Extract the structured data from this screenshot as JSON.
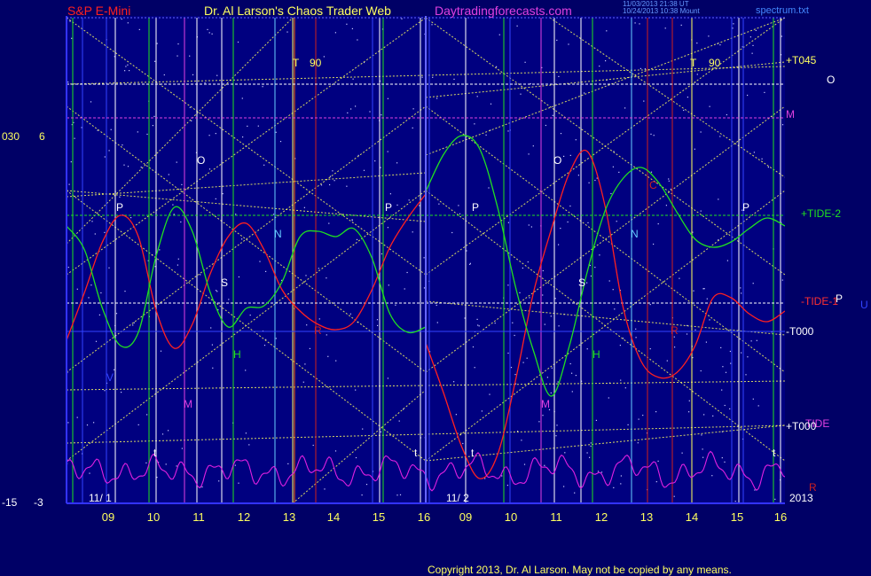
{
  "header": {
    "instrument": "S&P E-Mini",
    "title": "Dr. Al Larson's Chaos Trader Web",
    "site": "Daytradingforecasts.com",
    "timestamp_1": "11/03/2013 21:38 UT",
    "timestamp_2": "10/24/2013 10:38 Mount",
    "file": "spectrum.txt"
  },
  "left_axis": {
    "top_a": "030",
    "top_b": "6",
    "bottom_a": "-15",
    "bottom_b": "-3"
  },
  "right_labels": {
    "t045": "+T045",
    "o": "O",
    "m": "M",
    "tide2": "+TIDE-2",
    "tide1": "-TIDE-1",
    "p": "P",
    "u": "U",
    "t000_top": "-T000",
    "tide": "TIDE",
    "t000_bottom": "+T000",
    "r": "R",
    "year": "2013"
  },
  "footer": {
    "copyright": "Copyright 2013, Dr. Al Larson. May not be copied by any means."
  },
  "colors": {
    "background": "#000066",
    "price": "#ff2020",
    "flux": "#20e020",
    "spectrum": "#e020e0",
    "grid": "#ffff60",
    "white_line": "#ffffff",
    "frame": "#3333ff"
  },
  "chart_data": {
    "type": "line",
    "panels": [
      {
        "date_label": "11/ 1",
        "hour_ticks": [
          "09",
          "10",
          "11",
          "12",
          "13",
          "14",
          "15",
          "16"
        ],
        "markers": [
          {
            "text": "T",
            "kind": "yellow"
          },
          {
            "text": "90",
            "kind": "yellow"
          },
          {
            "text": "O",
            "kind": "white"
          },
          {
            "text": "P",
            "kind": "white"
          },
          {
            "text": "P",
            "kind": "white"
          },
          {
            "text": "N",
            "kind": "cyan"
          },
          {
            "text": "S",
            "kind": "white"
          },
          {
            "text": "H",
            "kind": "green"
          },
          {
            "text": "M",
            "kind": "magenta"
          },
          {
            "text": "R",
            "kind": "red"
          },
          {
            "text": "V",
            "kind": "blue"
          },
          {
            "text": "t",
            "kind": "white"
          },
          {
            "text": "t",
            "kind": "white"
          }
        ],
        "series": [
          {
            "name": "price",
            "values": [
              -1.4,
              0.4,
              2.3,
              3.3,
              2.5,
              -0.3,
              -1.7,
              -0.8,
              1.1,
              2.5,
              3.0,
              2.0,
              0.5,
              -0.3,
              -0.8,
              -1.0,
              -0.7,
              0.5,
              2.1,
              3.2,
              4.1
            ]
          },
          {
            "name": "flux",
            "values": [
              2.9,
              2.0,
              -0.2,
              -1.6,
              -1.1,
              1.8,
              3.6,
              2.7,
              0.4,
              -0.9,
              -0.2,
              -0.1,
              0.8,
              2.5,
              2.7,
              2.5,
              2.8,
              1.7,
              -0.4,
              -1.1,
              -0.9
            ]
          }
        ]
      },
      {
        "date_label": "11/ 2",
        "hour_ticks": [
          "09",
          "10",
          "11",
          "12",
          "13",
          "14",
          "15",
          "16"
        ],
        "markers": [
          {
            "text": "T",
            "kind": "yellow"
          },
          {
            "text": "90",
            "kind": "yellow"
          },
          {
            "text": "O",
            "kind": "white"
          },
          {
            "text": "P",
            "kind": "white"
          },
          {
            "text": "P",
            "kind": "white"
          },
          {
            "text": "N",
            "kind": "cyan"
          },
          {
            "text": "S",
            "kind": "white"
          },
          {
            "text": "H",
            "kind": "green"
          },
          {
            "text": "M",
            "kind": "magenta"
          },
          {
            "text": "R",
            "kind": "red"
          },
          {
            "text": "C",
            "kind": "red"
          },
          {
            "text": "t",
            "kind": "white"
          },
          {
            "text": "t",
            "kind": "white"
          }
        ],
        "series": [
          {
            "name": "price",
            "values": [
              -1.5,
              -3.4,
              -5.4,
              -6.6,
              -5.7,
              -2.9,
              0.4,
              2.8,
              4.9,
              5.7,
              3.6,
              -0.2,
              -2.2,
              -2.8,
              -2.6,
              -1.6,
              0.2,
              0.2,
              -0.4,
              -0.7,
              -0.3
            ]
          },
          {
            "name": "flux",
            "values": [
              4.2,
              5.6,
              6.3,
              5.8,
              3.6,
              0.6,
              -1.8,
              -3.5,
              -1.6,
              1.2,
              3.5,
              4.7,
              5.1,
              4.5,
              3.4,
              2.4,
              2.1,
              2.3,
              2.8,
              3.2,
              2.9
            ]
          }
        ]
      }
    ],
    "yrange": [
      -15,
      30
    ],
    "grid": true
  }
}
